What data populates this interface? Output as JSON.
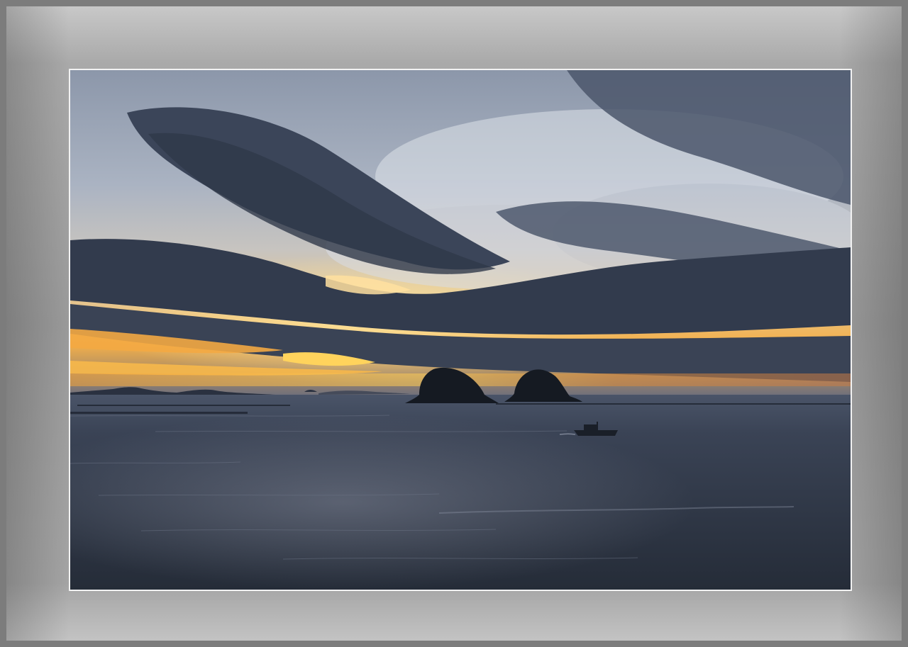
{
  "scene": {
    "subject": "sunset-over-sea-with-two-rocky-islets-and-boat",
    "colors": {
      "frame": "#9a9a9a",
      "frame_border": "#7c7c7c",
      "photo_border": "#f2f2f2",
      "sky_light": "#c9cfd8",
      "cloud_dark": "#353f52",
      "sunset_orange": "#f5a43a",
      "sunset_yellow": "#ffd25a",
      "sea": "#2c3442"
    }
  }
}
